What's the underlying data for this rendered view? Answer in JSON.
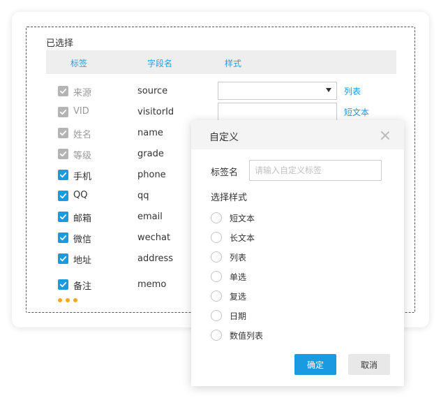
{
  "panel": {
    "selected_title": "已选择",
    "headers": {
      "label": "标签",
      "field": "字段名",
      "style": "样式"
    },
    "rows": [
      {
        "label": "来源",
        "field": "source",
        "checked": true,
        "editable": false,
        "style_link": "列表"
      },
      {
        "label": "VID",
        "field": "visitorId",
        "checked": true,
        "editable": false,
        "style_link": "短文本"
      },
      {
        "label": "姓名",
        "field": "name",
        "checked": true,
        "editable": false
      },
      {
        "label": "等级",
        "field": "grade",
        "checked": true,
        "editable": false
      },
      {
        "label": "手机",
        "field": "phone",
        "checked": true,
        "editable": true
      },
      {
        "label": "QQ",
        "field": "qq",
        "checked": true,
        "editable": true
      },
      {
        "label": "邮箱",
        "field": "email",
        "checked": true,
        "editable": true
      },
      {
        "label": "微信",
        "field": "wechat",
        "checked": true,
        "editable": true
      },
      {
        "label": "地址",
        "field": "address",
        "checked": true,
        "editable": true
      },
      {
        "label": "备注",
        "field": "memo",
        "checked": true,
        "editable": true
      }
    ],
    "select_value": "",
    "input_value": ""
  },
  "dialog": {
    "title": "自定义",
    "tag_label": "标签名",
    "tag_placeholder": "请输入自定义标签",
    "style_title": "选择样式",
    "options": [
      "短文本",
      "长文本",
      "列表",
      "单选",
      "复选",
      "日期",
      "数值列表"
    ],
    "ok_label": "确定",
    "cancel_label": "取消"
  },
  "colors": {
    "accent": "#1a9ae0",
    "disabled_check": "#b4b4b4",
    "dots": "#f5a623"
  },
  "icons": {
    "checkbox": "check-icon",
    "dropdown": "caret-down-icon",
    "close": "close-icon",
    "more": "more-dots-icon"
  }
}
